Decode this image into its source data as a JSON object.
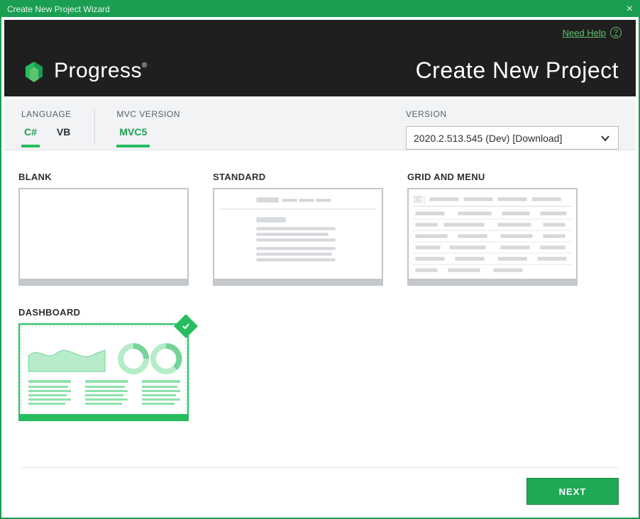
{
  "window": {
    "title": "Create New Project Wizard"
  },
  "header": {
    "brand": "Progress",
    "page_title": "Create New Project",
    "help_label": "Need Help"
  },
  "language": {
    "label": "LANGUAGE",
    "tabs": [
      {
        "label": "C#",
        "active": true
      },
      {
        "label": "VB",
        "active": false
      }
    ]
  },
  "mvc": {
    "label": "MVC VERSION",
    "tabs": [
      {
        "label": "MVC5",
        "active": true
      }
    ]
  },
  "version": {
    "label": "VERSION",
    "selected": "2020.2.513.545 (Dev) [Download]"
  },
  "templates": [
    {
      "id": "blank",
      "label": "BLANK",
      "selected": false
    },
    {
      "id": "standard",
      "label": "STANDARD",
      "selected": false
    },
    {
      "id": "grid-and-menu",
      "label": "GRID AND MENU",
      "selected": false
    },
    {
      "id": "dashboard",
      "label": "DASHBOARD",
      "selected": true
    }
  ],
  "footer": {
    "next_label": "NEXT"
  }
}
